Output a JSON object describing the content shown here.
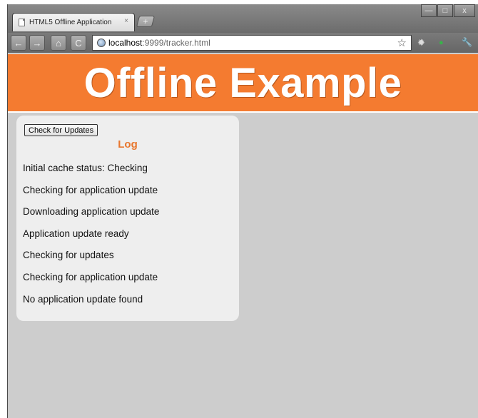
{
  "browser": {
    "tab_title": "HTML5 Offline Application",
    "tab_close": "×",
    "new_tab": "+",
    "window_controls": {
      "minimize": "—",
      "maximize": "□",
      "close": "x"
    },
    "nav": {
      "back": "←",
      "forward": "→",
      "home": "⌂",
      "reload": "C"
    },
    "address_host": "localhost",
    "address_rest": ":9999/tracker.html",
    "bookmark_star": "☆",
    "extensions": [
      "✹",
      "●",
      "🔧"
    ]
  },
  "page": {
    "banner_title": "Offline Example",
    "banner_color": "#f47b30",
    "check_button_label": "Check for Updates",
    "log_title": "Log",
    "log_title_color": "#e8772e",
    "log_entries": [
      "Initial cache status: Checking",
      "Checking for application update",
      "Downloading application update",
      "Application update ready",
      "Checking for updates",
      "Checking for application update",
      "No application update found"
    ]
  }
}
